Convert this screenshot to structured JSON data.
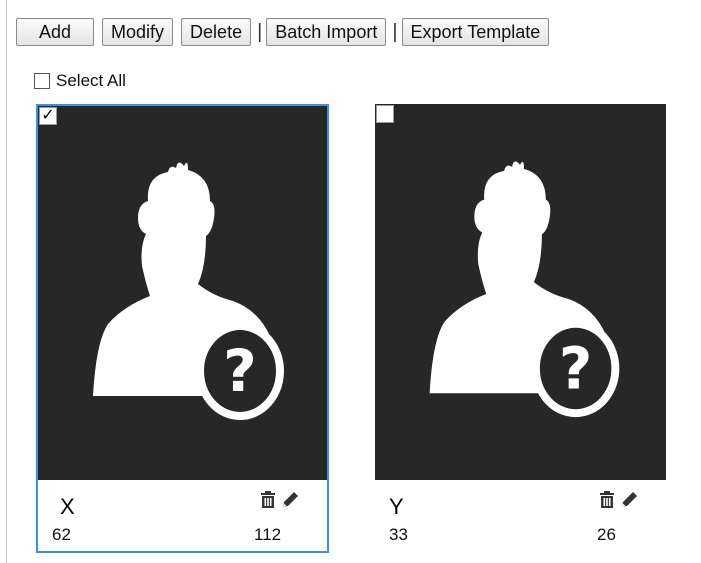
{
  "toolbar": {
    "add_label": "Add",
    "modify_label": "Modify",
    "delete_label": "Delete",
    "separator": "|",
    "batch_import_label": "Batch Import",
    "export_template_label": "Export Template"
  },
  "select_all": {
    "label": "Select All",
    "checked": false
  },
  "cards": [
    {
      "name": "X",
      "left_value": "62",
      "right_value": "112",
      "checked": true,
      "check_mark": "✓"
    },
    {
      "name": "Y",
      "left_value": "33",
      "right_value": "26",
      "checked": false,
      "check_mark": ""
    }
  ],
  "colors": {
    "photo_bg": "#272727",
    "selected_border": "#3b8fe8",
    "silhouette": "#ffffff"
  },
  "icons": {
    "delete": "trash-icon",
    "edit": "pencil-icon",
    "placeholder": "unknown-person-icon"
  }
}
